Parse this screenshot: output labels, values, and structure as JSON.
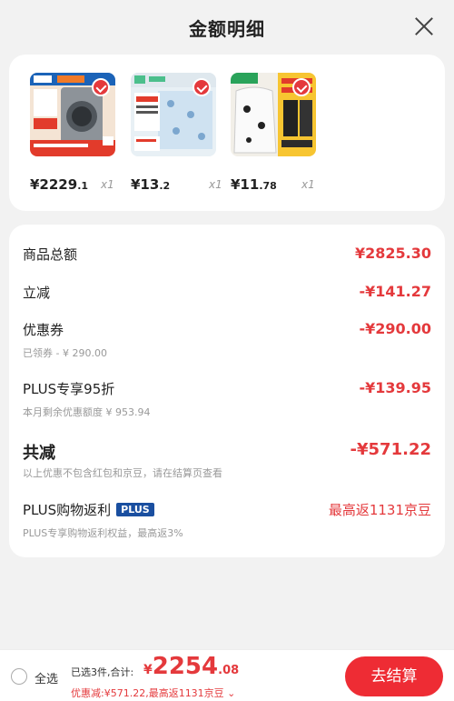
{
  "header": {
    "title": "金额明细"
  },
  "products": [
    {
      "price_int": "¥2229",
      "price_dec": ".1",
      "qty": "x1"
    },
    {
      "price_int": "¥13",
      "price_dec": ".2",
      "qty": "x1"
    },
    {
      "price_int": "¥11",
      "price_dec": ".78",
      "qty": "x1"
    }
  ],
  "summary": {
    "goods_total": {
      "label": "商品总额",
      "value": "¥2825.30"
    },
    "instant_discount": {
      "label": "立减",
      "value": "-¥141.27"
    },
    "coupon": {
      "label": "优惠券",
      "value": "-¥290.00",
      "sub": "已领券 - ¥ 290.00"
    },
    "plus_discount": {
      "label": "PLUS专享95折",
      "value": "-¥139.95",
      "sub": "本月剩余优惠额度 ¥ 953.94"
    },
    "total_discount": {
      "label": "共减",
      "value": "-¥571.22",
      "sub": "以上优惠不包含红包和京豆，请在结算页查看"
    },
    "plus_rebate": {
      "label": "PLUS购物返利",
      "badge": "PLUS",
      "value": "最高返1131京豆",
      "sub": "PLUS专享购物返利权益，最高返3%"
    }
  },
  "footer": {
    "select_all": "全选",
    "count_text": "已选3件,合计:",
    "total_yen": "¥",
    "total_int": "2254",
    "total_dec": ".08",
    "discount_text": "优惠减:¥571.22,最高返1131京豆 ⌄",
    "checkout": "去结算"
  },
  "colors": {
    "accent": "#e4393c",
    "plus_badge": "#1a4fa0"
  }
}
